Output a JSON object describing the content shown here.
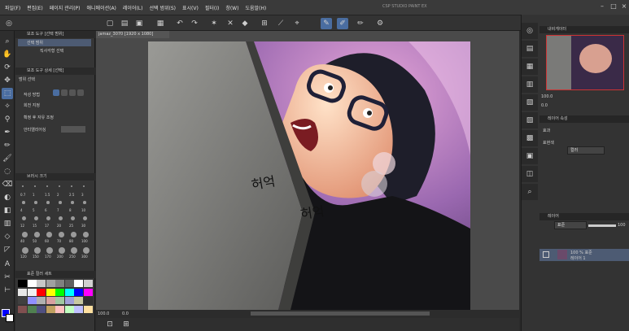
{
  "menu": [
    "파일(F)",
    "편집(E)",
    "페이지 관리(P)",
    "애니메이션(A)",
    "레이어(L)",
    "선택 범위(S)",
    "표시(V)",
    "필터(I)",
    "창(W)",
    "도움말(H)"
  ],
  "window_title": "CSP STUDIO PAINT EX",
  "toolbar_icons": [
    "magnifier-icon",
    "hand-icon",
    "rotate-icon",
    "move-icon",
    "selection-icon",
    "wand-icon",
    "eyedropper-icon",
    "pen-icon",
    "pencil-icon",
    "brush-icon",
    "airbrush-icon",
    "eraser-icon",
    "blend-icon",
    "fill-icon",
    "gradient-icon",
    "figure-icon",
    "frame-icon",
    "ruler-icon",
    "text-icon",
    "balloon-icon",
    "correct-line-icon"
  ],
  "left_panel": {
    "subtool_title": "보조 도구 [선택 범위]",
    "subtool_selected": "선택 범위",
    "subtool_row2": "직사각형 선택",
    "detail_title": "보조 도구 상세 [선택]",
    "detail_subtitle": "범위 선택",
    "mode_label": "작성 방법",
    "row_rotate": "회전 지정",
    "row_after": "확정 후 자유 조정",
    "row_antialias": "안티앨리어싱",
    "brush_size_title": "브러시 크기",
    "color_set_title": "표준 컬러 세트",
    "brush_size_labels": [
      "0.7",
      "1",
      "1.5",
      "2",
      "2.5",
      "3",
      "4",
      "5",
      "6",
      "7",
      "8",
      "10",
      "12",
      "15",
      "17",
      "20",
      "25",
      "30",
      "40",
      "50",
      "60",
      "70",
      "80",
      "100",
      "120",
      "150",
      "170",
      "200",
      "250",
      "300"
    ]
  },
  "document": {
    "tab_label": "jamaz_3070 [1920 x 1080]",
    "status_zoom": "100.0",
    "status_angle": "0.0"
  },
  "artwork": {
    "korean_text_1": "허억",
    "korean_text_2": "허억"
  },
  "right_panel": {
    "navigator_title": "내비게이터",
    "navigator_zoom": "100.0",
    "navigator_angle": "0.0",
    "layer_prop_title": "레이어 속성",
    "effect_label": "효과",
    "color_label": "표현색",
    "color_value": "컬러",
    "layer_title": "레이어",
    "blend_mode": "표준",
    "opacity": "100",
    "layer_name": "100 % 표준",
    "layer_sub": "레이어 1"
  },
  "colors": {
    "accent": "#4a6da0",
    "panel": "#353535",
    "swatches": [
      "#000000",
      "#ffffff",
      "#c8c8c8",
      "#a0a0a0",
      "#808080",
      "#606060",
      "#ffffff",
      "#d0d0d0",
      "#e8e8e8",
      "#f0f0f0",
      "#ff0000",
      "#ffff00",
      "#00ff00",
      "#00ffff",
      "#0000ff",
      "#ff00ff",
      "#404040",
      "#9090ff",
      "#b0b0b0",
      "#d8a0a0",
      "#a0c8a0",
      "#a0a0d8",
      "#c8c8a0",
      "#303030",
      "#805050",
      "#508050",
      "#505080",
      "#c0a060",
      "#ffc0c0",
      "#c0ffc0",
      "#c0c0ff",
      "#ffe0a0"
    ]
  }
}
